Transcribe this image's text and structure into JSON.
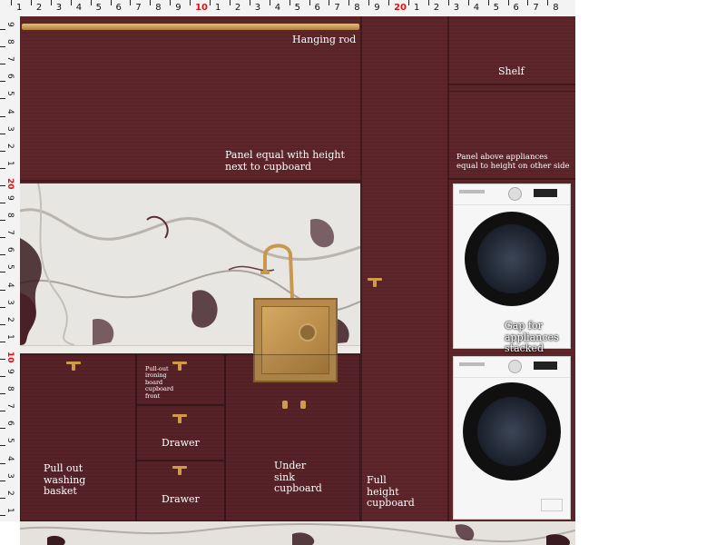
{
  "ruler": {
    "top_numbers": [
      "1",
      "2",
      "3",
      "4",
      "5",
      "6",
      "7",
      "8",
      "9",
      "10",
      "1",
      "2",
      "3",
      "4",
      "5",
      "6",
      "7",
      "8",
      "9",
      "20",
      "1",
      "2",
      "3",
      "4",
      "5",
      "6",
      "7",
      "8"
    ],
    "left_numbers": [
      "9",
      "8",
      "7",
      "6",
      "5",
      "4",
      "3",
      "2",
      "1",
      "20",
      "9",
      "8",
      "7",
      "6",
      "5",
      "4",
      "3",
      "2",
      "1",
      "10",
      "9",
      "8",
      "7",
      "6",
      "5",
      "4",
      "3",
      "2",
      "1"
    ]
  },
  "labels": {
    "hanging_rod": "Hanging rod",
    "shelf": "Shelf",
    "panel_equal_line1": "Panel equal with height",
    "panel_equal_line2": "next to cupboard",
    "panel_above_line1": "Panel above appliances",
    "panel_above_line2": "equal to height on other side",
    "gap_line1": "Gap for",
    "gap_line2": "appliances",
    "gap_line3": "stacked",
    "ironing_line1": "Pull-out",
    "ironing_line2": "ironing",
    "ironing_line3": "board",
    "ironing_line4": "cupboard",
    "ironing_line5": "front",
    "drawer_1": "Drawer",
    "drawer_2": "Drawer",
    "pull_out_line1": "Pull out",
    "pull_out_line2": "washing",
    "pull_out_line3": "basket",
    "under_sink_line1": "Under",
    "under_sink_line2": "sink",
    "under_sink_line3": "cupboard",
    "full_height_line1": "Full",
    "full_height_line2": "height",
    "full_height_line3": "cupboard"
  },
  "colors": {
    "cabinet": "#5a2328",
    "brass": "#d09a4b",
    "marble": "#e7e4e0",
    "ruler_red": "#d11111"
  },
  "icons": {
    "rod": "hanging-rod-icon",
    "sink": "square-sink-icon",
    "tap": "gooseneck-tap-icon",
    "dryer": "tumble-dryer-icon",
    "washer": "washing-machine-icon",
    "handle": "t-bar-handle-icon"
  }
}
